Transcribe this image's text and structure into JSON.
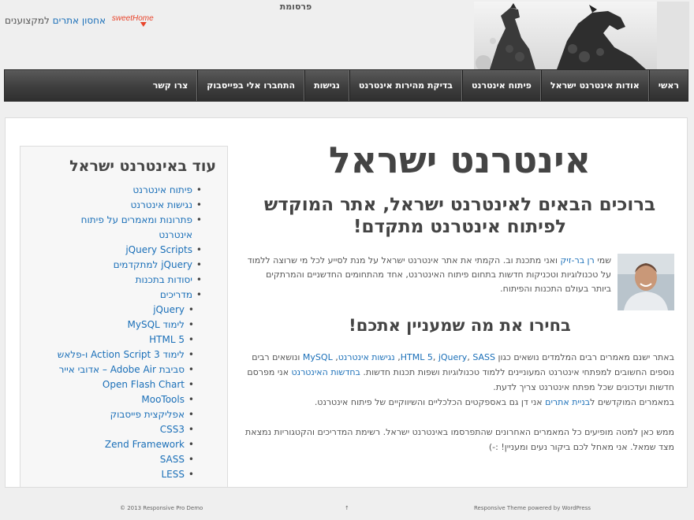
{
  "header": {
    "ad_label": "פרסומת",
    "sponsor": {
      "logo_text": "sweetHome",
      "link": "אחסון אתרים",
      "rest": "למקצוענים"
    }
  },
  "nav": [
    "ראשי",
    "אודות אינטרנט ישראל",
    "פיתוח אינטרנט",
    "בדיקת מהירות אינטרנט",
    "נגישות",
    "התחברו אלי בפייסבוק",
    "צרו קשר"
  ],
  "main": {
    "title": "אינטרנט ישראל",
    "welcome": "ברוכים הבאים לאינטרנט ישראל, אתר המוקדש לפיתוח אינטרנט מתקדם!",
    "intro": {
      "pre": "שמי ",
      "name_link": "רן בר-זיק",
      "post": " ואני מתכנת וב. הקמתי את אתר אינטרנט ישראל על מנת לסייע לכל מי שרוצה ללמוד על טכנולוגיות וטכניקות חדשות בתחום פיתוח האינטרנט, אחד מהתחומים החדשניים והמרתקים ביותר בעולם התכנות והפיתוח."
    },
    "choose_heading": "בחירו את מה שמעניין אתכם!",
    "body": {
      "t1": "באתר ישנם מאמרים רבים המלמדים נושאים כגון ",
      "l1": "HTML 5",
      "s1": ", ",
      "l2": "jQuery",
      "s2": ", ",
      "l3": "SASS",
      "s3": ", ",
      "l4": "נגישות אינטרנט",
      "s4": ", ",
      "l5": "MySQL",
      "t2": " ונושאים רבים נוספים החשובים למפתחי אינטרנט המעוניינים ללמוד טכנולוגיות ושפות תכנות חדשות. ",
      "l6": "בחדשות האינטרנט",
      "t3": " אני מפרסם חדשות ועדכונים שכל מפתח אינטרנט צריך לדעת.",
      "t4": "במאמרים המוקדשים ל",
      "l7": "בניית אתרים",
      "t5": " אני דן גם באספקטים הכלכליים והשיווקיים של פיתוח אינטרנט.",
      "t6": "ממש כאן למטה מופיעים כל המאמרים האחרונים שהתפרסמו באינטרנט ישראל. רשימת המדריכים והקטגוריות נמצאת מצד שמאל. אני מאחל לכם ביקור נעים ומעניין! :-)"
    }
  },
  "sidebar": {
    "title": "עוד באינטרנט ישראל",
    "items": [
      "פיתוח אינטרנט",
      "נגישות אינטרנט",
      "פתרונות ומאמרים על פיתוח",
      "אינטרנט",
      "jQuery Scripts",
      "jQuery למתקדמים",
      "יסודות בתכנות"
    ],
    "guides_label": "מדריכים",
    "guides": [
      "jQuery",
      "לימוד MySQL",
      "HTML 5",
      "לימוד Action Script 3 ו-פלאש",
      "סביבת Adobe Air – אדובי אייר",
      "Open Flash Chart",
      "MooTools",
      "אפליקצית פייסבוק",
      "CSS3",
      "Zend Framework",
      "SASS",
      "LESS"
    ]
  },
  "footer": {
    "copyright": "© 2013 Responsive Pro Demo",
    "to_top": "↑",
    "credit": "Responsive Theme powered by WordPress"
  }
}
